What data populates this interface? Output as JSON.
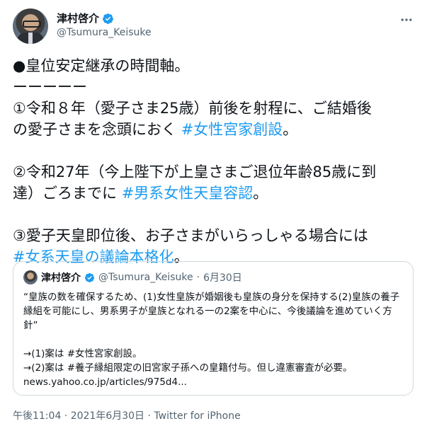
{
  "author": {
    "display_name": "津村啓介",
    "handle": "@Tsumura_Keisuke"
  },
  "tweet": {
    "lines": [
      {
        "text": "●皇位安定継承の時間軸。"
      },
      {
        "text": "ーーーーー"
      },
      {
        "text": "①令和８年（愛子さま25歳）前後を射程に、ご結婚後"
      },
      {
        "text": "の愛子さまを念頭におく ",
        "hashtag": "#女性宮家創設",
        "suffix": "。"
      },
      {
        "text": ""
      },
      {
        "text": "②令和27年（今上陛下が上皇さまご退位年齢85歳に到"
      },
      {
        "text": "達）ごろまでに ",
        "hashtag": "#男系女性天皇容認",
        "suffix": "。"
      },
      {
        "text": ""
      },
      {
        "text": "③愛子天皇即位後、お子さまがいらっしゃる場合には"
      },
      {
        "text": "",
        "hashtag": "#女系天皇の議論本格化",
        "suffix": "。"
      }
    ]
  },
  "quote": {
    "display_name": "津村啓介",
    "handle": "@Tsumura_Keisuke",
    "separator": "·",
    "date": "6月30日",
    "body": "“皇族の数を確保するため、(1)女性皇族が婚姻後も皇族の身分を保持する(2)皇族の養子縁組を可能にし、男系男子が皇族となれる一の2案を中心に、今後議論を進めていく方針”\n\n→(1)案は #女性宮家創設。\n→(2)案は #養子縁組限定の旧宮家子孫への皇籍付与。但し違憲審査が必要。\nnews.yahoo.co.jp/articles/975d4..."
  },
  "footer": {
    "timestamp": "午後11:04 · 2021年6月30日 · Twitter for iPhone"
  },
  "colors": {
    "hashtag": "#1d9bf0",
    "verified": "#1d9bf0",
    "muted": "#536471",
    "border": "#cfd9de"
  },
  "icons": {
    "verified": "verified-badge-icon",
    "more": "more-options-icon"
  }
}
